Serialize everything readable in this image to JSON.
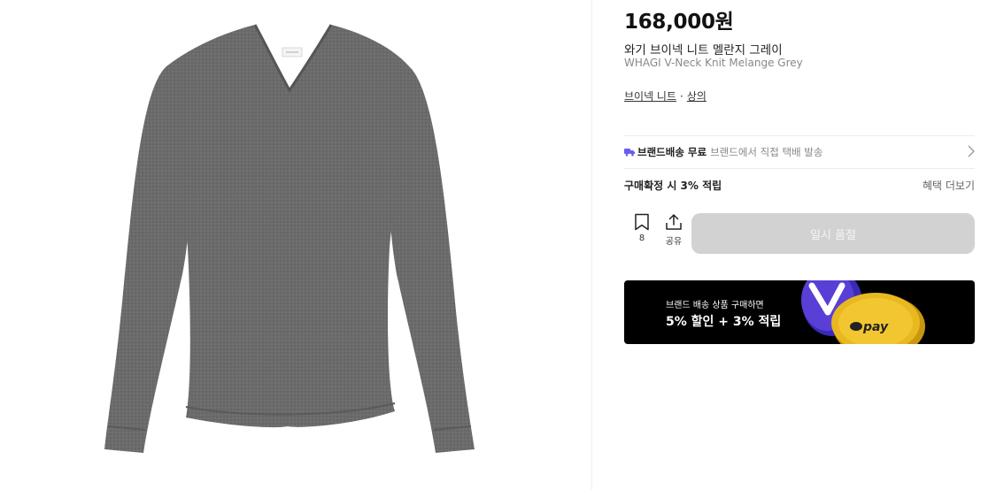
{
  "product": {
    "price": "168,000원",
    "name_ko": "와기 브이넥 니트 멜란지 그레이",
    "name_en": "WHAGI V-Neck Knit Melange Grey",
    "category_1": "브이넥 니트",
    "category_separator": "·",
    "category_2": "상의",
    "image_alt": "grey v-neck knit sweater"
  },
  "shipping": {
    "icon": "truck-icon",
    "title": "브랜드배송 무료",
    "description": "브랜드에서 직접 택배 발송"
  },
  "benefit": {
    "label": "구매확정 시 3% 적립",
    "link": "혜택 더보기"
  },
  "actions": {
    "bookmark_count": "8",
    "share_label": "공유",
    "buy_label": "일시 품절"
  },
  "banner": {
    "line1": "브랜드 배송 상품 구매하면",
    "line2": "5% 할인 + 3% 적립",
    "coin_text": "pay"
  },
  "colors": {
    "truck": "#6b5cf0",
    "button_disabled": "#d2d2d2",
    "banner_bg": "#000000",
    "coin_gold": "#e8b820",
    "coin_purple": "#5a3fd6"
  }
}
